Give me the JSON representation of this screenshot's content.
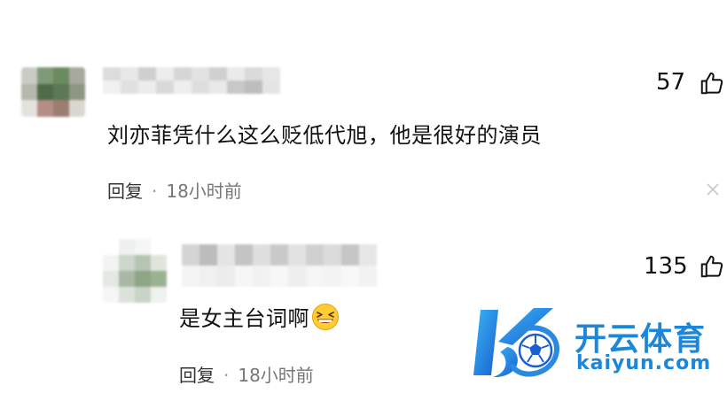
{
  "comments": [
    {
      "likes": "57",
      "text": "刘亦菲凭什么这么贬低代旭，他是很好的演员",
      "reply_label": "回复",
      "separator": "·",
      "time": "18小时前"
    },
    {
      "likes": "135",
      "text": "是女主台词啊",
      "emoji": "grinning-squinting-face",
      "reply_label": "回复",
      "separator": "·",
      "time": "18小时前"
    }
  ],
  "watermark": {
    "title": "开云体育",
    "url": "kaiyun.com",
    "color": "#1c86d9"
  },
  "icons": {
    "like": "thumbs-up-icon",
    "close": "close-icon"
  }
}
